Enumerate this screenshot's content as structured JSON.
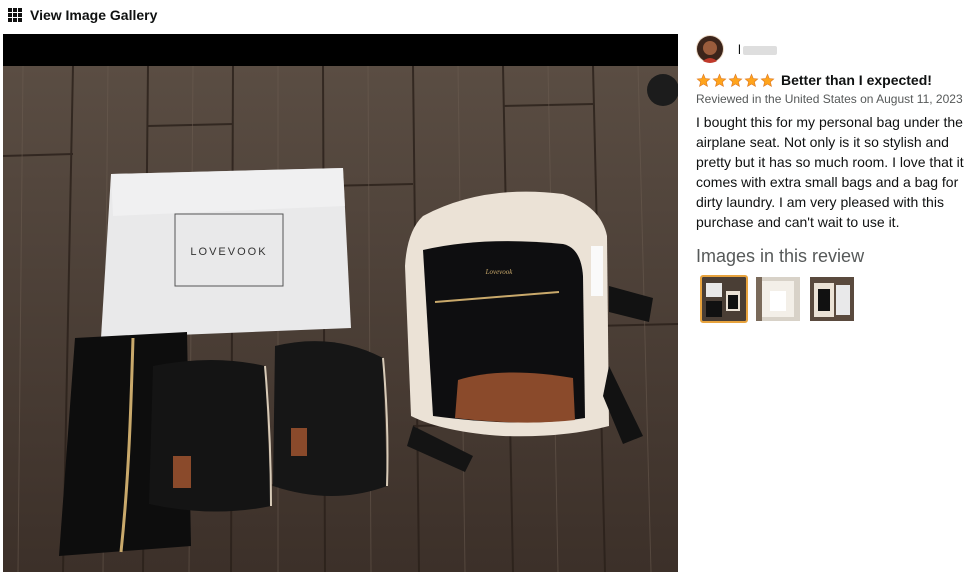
{
  "header": {
    "icon": "grid-icon",
    "title": "View Image Gallery"
  },
  "review": {
    "reviewer_name": "l",
    "rating": 5,
    "title": "Better than I expected!",
    "meta": "Reviewed in the United States on August 11, 2023",
    "body": "I bought this for my personal bag under the airplane seat. Not only is it so stylish and pretty but it has so much room. I love that it comes with extra small bags and a bag for dirty laundry. I am very pleased with this purchase and can't wait to use it."
  },
  "images": {
    "heading": "Images in this review",
    "thumbnails": [
      {
        "name": "thumb-1",
        "selected": true
      },
      {
        "name": "thumb-2",
        "selected": false
      },
      {
        "name": "thumb-3",
        "selected": false
      }
    ]
  },
  "photo": {
    "dust_bag_brand": "LOVEVOOK",
    "backpack_logo": "Lovevook"
  },
  "colors": {
    "star": "#ffa41c",
    "selected_border": "#e7a33e",
    "meta_text": "#565959"
  }
}
